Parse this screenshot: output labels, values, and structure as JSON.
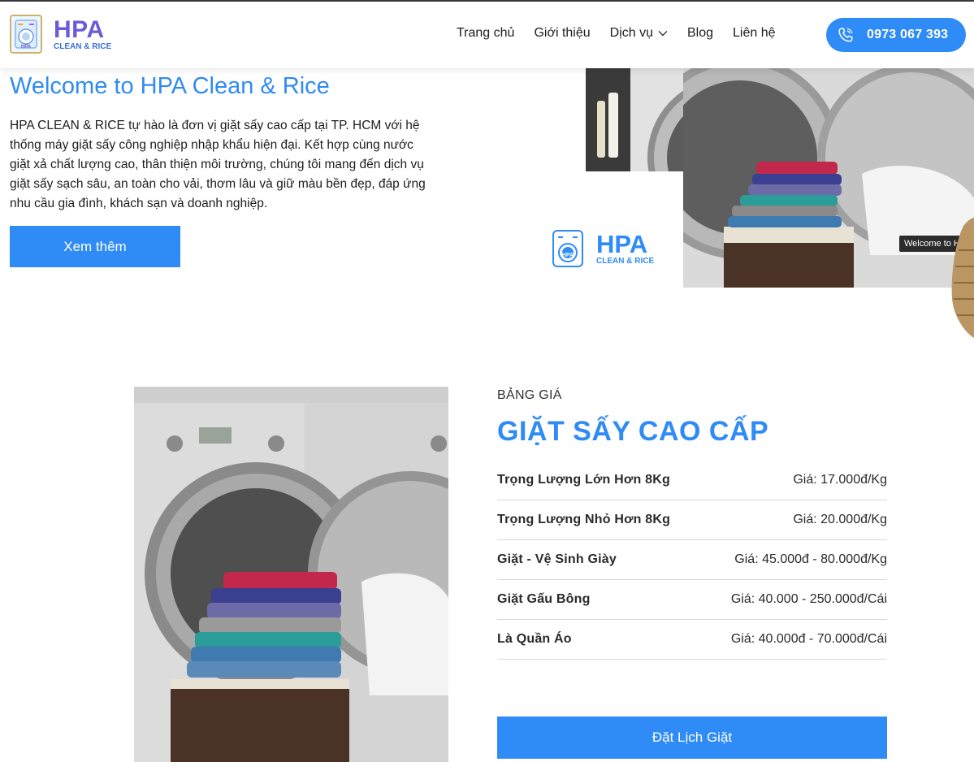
{
  "header": {
    "logo": {
      "main": "HPA",
      "sub": "CLEAN & RICE",
      "badge": "HPA"
    },
    "nav": [
      {
        "label": "Trang chủ"
      },
      {
        "label": "Giới thiệu"
      },
      {
        "label": "Dịch vụ",
        "has_dropdown": true
      },
      {
        "label": "Blog"
      },
      {
        "label": "Liên hệ"
      }
    ],
    "phone": "0973 067 393"
  },
  "welcome": {
    "title": "Welcome to HPA Clean & Rice",
    "description": "HPA CLEAN & RICE tự hào là đơn vị giặt sấy cao cấp tại TP. HCM với hệ thống máy giặt sấy công nghiệp nhập khẩu hiện đại. Kết hợp cùng nước giặt xả chất lượng cao, thân thiện môi trường, chúng tôi mang đến dịch vụ giặt sấy sạch sâu, an toàn cho vải, thơm lâu và giữ màu bền đẹp, đáp ứng nhu cầu gia đình, khách sạn và doanh nghiệp.",
    "more_label": "Xem thêm",
    "hero_logo": {
      "main": "HPA",
      "sub": "CLEAN & RICE",
      "badge": "HPA"
    },
    "hero_tag": "Welcome to HPA"
  },
  "pricing": {
    "kicker": "BẢNG GIÁ",
    "title": "GIẶT SẤY CAO CẤP",
    "items": [
      {
        "name": "Trọng Lượng Lớn Hơn 8Kg",
        "price": "Giá: 17.000đ/Kg"
      },
      {
        "name": "Trọng Lượng Nhỏ Hơn 8Kg",
        "price": "Giá: 20.000đ/Kg"
      },
      {
        "name": "Giặt - Vệ Sinh Giày",
        "price": "Giá: 45.000đ - 80.000đ/Kg"
      },
      {
        "name": "Giặt Gấu Bông",
        "price": "Giá: 40.000 - 250.000đ/Cái"
      },
      {
        "name": "Là Quần Áo",
        "price": "Giá: 40.000đ - 70.000đ/Cái"
      }
    ],
    "book_label": "Đặt Lịch Giặt"
  },
  "colors": {
    "accent": "#2f8bf5",
    "text": "#1d1d1d",
    "divider": "#d8d8d8"
  }
}
